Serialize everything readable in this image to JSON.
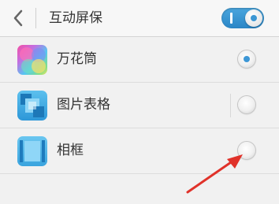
{
  "header": {
    "title": "互动屏保",
    "back_icon": "chevron-left-icon",
    "toggle_state": "on"
  },
  "list": {
    "items": [
      {
        "label": "万花筒",
        "icon": "kaleidoscope-thumbnail",
        "selected": true
      },
      {
        "label": "图片表格",
        "icon": "picture-grid-thumbnail",
        "selected": false
      },
      {
        "label": "相框",
        "icon": "photo-frame-thumbnail",
        "selected": false
      }
    ]
  },
  "colors": {
    "accent": "#2b86c6",
    "annotation_arrow": "#e0322a",
    "background": "#f1f1f1"
  }
}
